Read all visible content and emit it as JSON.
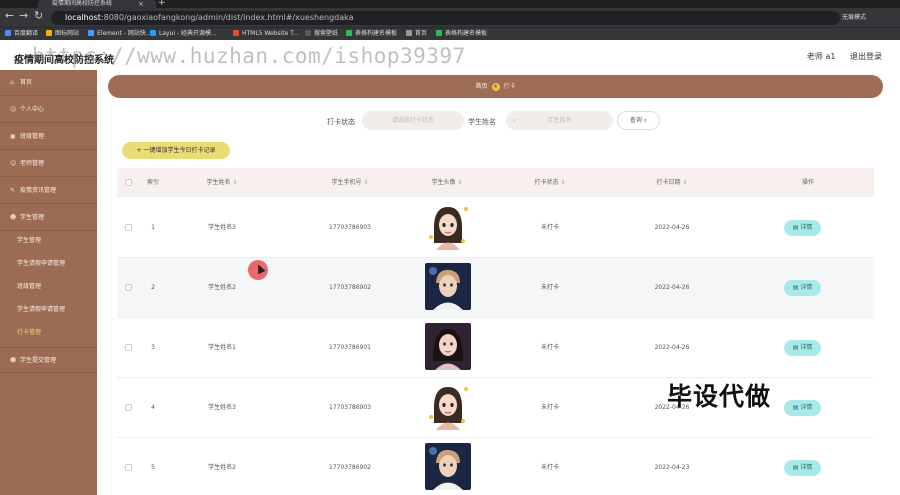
{
  "browser": {
    "tab_title": "疫情期间高校防控系统",
    "url_host": "localhost",
    "url_rest": ":8080/gaoxiaofangkong/admin/dist/index.html#/xueshengdaka",
    "profile": "无痕模式",
    "bookmarks": [
      "百度翻译",
      "图标网站",
      "Element - 网站快...",
      "Layui - 经典开源模...",
      "HTML5 Website T...",
      "搜索壁纸",
      "表格构建名模板",
      "首页",
      "表格构建名模板"
    ]
  },
  "header": {
    "title": "疫情期间高校防控系统",
    "user": "老师 a1",
    "logout": "退出登录",
    "watermark": "https://www.huzhan.com/ishop39397"
  },
  "sidebar": {
    "items": [
      "首页",
      "个人中心",
      "班级管理",
      "老师管理",
      "疫情资讯管理",
      "学生管理"
    ],
    "sub_items": [
      "学生管理",
      "学生请假申请管理",
      "班级管理",
      "学生请假申请管理",
      "打卡管理"
    ],
    "last_item": "学生提交管理"
  },
  "breadcrumb": {
    "home": "首页",
    "current": "打卡"
  },
  "filter": {
    "status_label": "打卡状态",
    "status_placeholder": "请选择打卡状态",
    "name_label": "学生姓名",
    "name_placeholder": "学生姓名",
    "search_label": "查询"
  },
  "add_button": "一键增加学生今日打卡记录",
  "table": {
    "headers": [
      "索引",
      "学生姓名",
      "学生手机号",
      "学生头像",
      "打卡状态",
      "打卡日期",
      "操作"
    ],
    "rows": [
      {
        "index": "1",
        "name": "学生姓名3",
        "phone": "17703786903",
        "avatar": "cartoon-girl",
        "status": "未打卡",
        "date": "2022-04-26",
        "action": "详情"
      },
      {
        "index": "2",
        "name": "学生姓名2",
        "phone": "17703786902",
        "avatar": "young-man",
        "status": "未打卡",
        "date": "2022-04-26",
        "action": "详情"
      },
      {
        "index": "3",
        "name": "学生姓名1",
        "phone": "17703786901",
        "avatar": "young-woman",
        "status": "未打卡",
        "date": "2022-04-26",
        "action": "详情"
      },
      {
        "index": "4",
        "name": "学生姓名3",
        "phone": "17703786903",
        "avatar": "cartoon-girl",
        "status": "未打卡",
        "date": "2022-04-26",
        "action": "详情"
      },
      {
        "index": "5",
        "name": "学生姓名2",
        "phone": "17703786902",
        "avatar": "young-man",
        "status": "未打卡",
        "date": "2022-04-23",
        "action": "详情"
      }
    ]
  },
  "overlay": "毕设代做",
  "colors": {
    "sidebar": "#9b6c53",
    "breadcrumb": "#9e6d54",
    "add_button": "#e9dc74",
    "detail_button": "#a9e9e9",
    "active_sub": "#e8d36a"
  }
}
